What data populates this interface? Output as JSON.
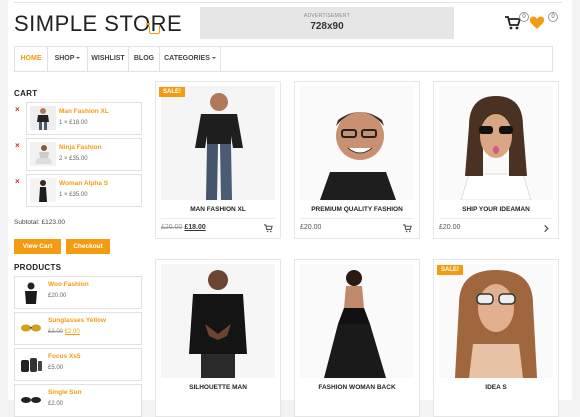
{
  "brand": {
    "name": "SIMPLE STORE"
  },
  "ad": {
    "label": "ADVERTISEMENT",
    "size": "728x90"
  },
  "header": {
    "cart_count": "0",
    "wishlist_count": "0"
  },
  "nav": {
    "items": [
      {
        "label": "HOME",
        "active": true,
        "dropdown": false
      },
      {
        "label": "SHOP",
        "active": false,
        "dropdown": true
      },
      {
        "label": "WISHLIST",
        "active": false,
        "dropdown": false
      },
      {
        "label": "BLOG",
        "active": false,
        "dropdown": false
      },
      {
        "label": "CATEGORIES",
        "active": false,
        "dropdown": true
      }
    ]
  },
  "sidebar": {
    "cart_title": "CART",
    "cart_items": [
      {
        "name": "Man Fashion XL",
        "qty_price": "1 × £18.00"
      },
      {
        "name": "Ninja Fashion",
        "qty_price": "2 × £35.00"
      },
      {
        "name": "Woman Alpha S",
        "qty_price": "1 × £35.00"
      }
    ],
    "remove_symbol": "×",
    "subtotal_label": "Subtotal:",
    "subtotal_value": "£123.00",
    "view_cart_label": "View Cart",
    "checkout_label": "Checkout",
    "products_title": "PRODUCTS",
    "products": [
      {
        "name": "Woo Fashion",
        "price": "£20.00",
        "old_price": ""
      },
      {
        "name": "Sunglasses Yellow",
        "price": "£2.00",
        "old_price": "£3.00"
      },
      {
        "name": "Focus Xs5",
        "price": "£5.00",
        "old_price": ""
      },
      {
        "name": "Single Sun",
        "price": "£2.00",
        "old_price": ""
      }
    ]
  },
  "products": [
    {
      "title": "MAN FASHION XL",
      "old_price": "£20.00",
      "price": "£18.00",
      "sale": true,
      "sale_label": "SALE!",
      "action": "cart"
    },
    {
      "title": "PREMIUM QUALITY FASHION",
      "old_price": "",
      "price": "£20.00",
      "sale": false,
      "sale_label": "",
      "action": "cart"
    },
    {
      "title": "SHIP YOUR IDEAMAN",
      "old_price": "",
      "price": "£20.00",
      "sale": false,
      "sale_label": "",
      "action": "chevron"
    },
    {
      "title": "SILHOUETTE MAN",
      "old_price": "",
      "price": "",
      "sale": false,
      "sale_label": "",
      "action": ""
    },
    {
      "title": "FASHION WOMAN BACK",
      "old_price": "",
      "price": "",
      "sale": false,
      "sale_label": "",
      "action": ""
    },
    {
      "title": "IDEA S",
      "old_price": "",
      "price": "",
      "sale": true,
      "sale_label": "SALE!",
      "action": ""
    }
  ],
  "colors": {
    "accent": "#f39c12",
    "remove": "#d9302c",
    "border": "#e2e2e2"
  }
}
